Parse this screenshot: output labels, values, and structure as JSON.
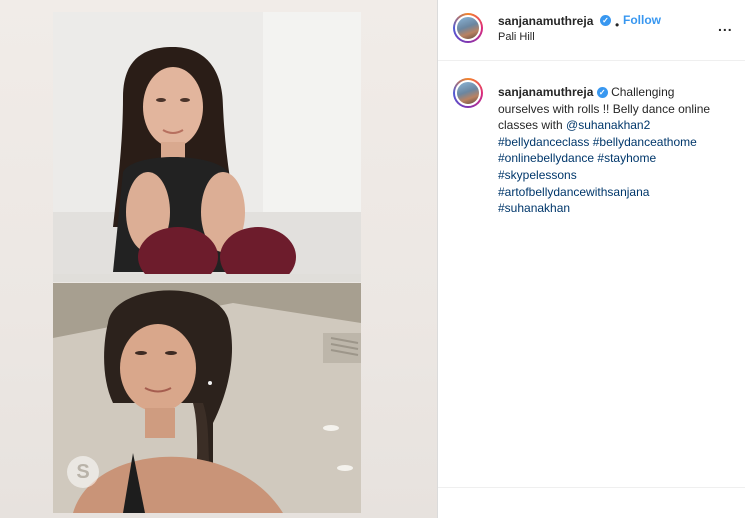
{
  "post": {
    "username": "sanjanamuthreja",
    "follow_label": "Follow",
    "dot": "•",
    "location": "Pali Hill",
    "more_label": "...",
    "verified_mark": "✓"
  },
  "caption": {
    "username": "sanjanamuthreja",
    "text": "Challenging ourselves with rolls !! Belly dance online classes with",
    "mention": "@suhanakhan2",
    "hashtags": [
      "#bellydanceclass",
      "#bellydanceathome",
      "#onlinebellydance",
      "#stayhome",
      "#skypelessons",
      "#artofbellydancewithsanjana",
      "#suhanakhan"
    ]
  },
  "media": {
    "watermark_letter": "S"
  },
  "colors": {
    "link": "#00376b",
    "accent": "#3897f0",
    "text": "#262626"
  }
}
